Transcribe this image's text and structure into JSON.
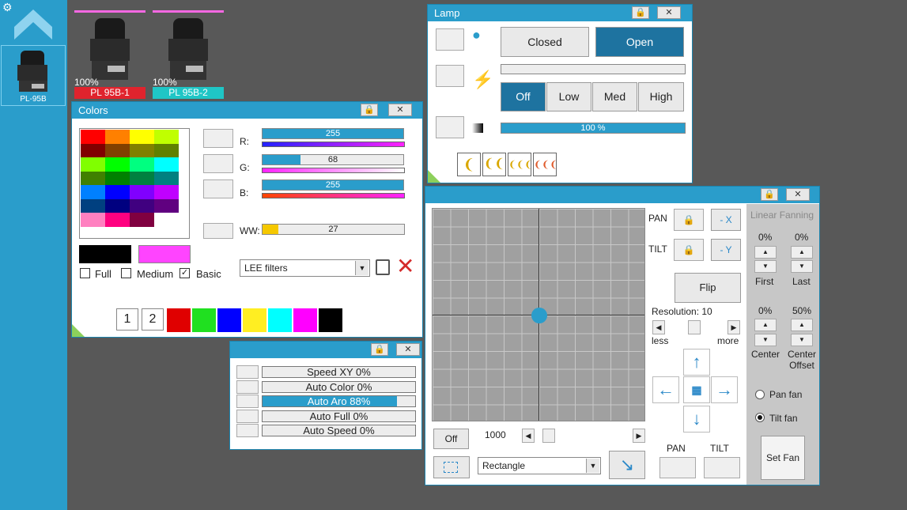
{
  "sidebar": {
    "fixture_label": "PL-95B"
  },
  "fixtures": [
    {
      "percent": "100%",
      "name": "PL 95B-1",
      "color": "#e0232d"
    },
    {
      "percent": "100%",
      "name": "PL 95B-2",
      "color": "#1fc6c6"
    }
  ],
  "lamp": {
    "title": "Lamp",
    "closed_label": "Closed",
    "open_label": "Open",
    "power_levels": [
      "Off",
      "Low",
      "Med",
      "High"
    ],
    "active_power": "Off",
    "dimmer_text": "100 %",
    "dimmer_value": 1.0
  },
  "colors": {
    "title": "Colors",
    "channels": [
      {
        "label": "R:",
        "value": "255",
        "fraction": 1.0
      },
      {
        "label": "G:",
        "value": "68",
        "fraction": 0.27
      },
      {
        "label": "B:",
        "value": "255",
        "fraction": 1.0
      },
      {
        "label": "WW:",
        "value": "27",
        "fraction": 0.11
      }
    ],
    "current_color": "#000000",
    "target_color": "#ff44ff",
    "palette": [
      [
        "#ff0000",
        "#ff8000",
        "#ffff00",
        "#c0ff00"
      ],
      [
        "#800000",
        "#804000",
        "#808000",
        "#608000"
      ],
      [
        "#80ff00",
        "#00ff00",
        "#00ff80",
        "#00ffff"
      ],
      [
        "#408000",
        "#008000",
        "#008040",
        "#008080"
      ],
      [
        "#0080ff",
        "#0000ff",
        "#8000ff",
        "#c000ff"
      ],
      [
        "#004080",
        "#000080",
        "#400080",
        "#600080"
      ],
      [
        "#ff80c0",
        "#ff0080",
        "#800040",
        "#ffffff"
      ]
    ],
    "modes": [
      {
        "label": "Full",
        "checked": false
      },
      {
        "label": "Medium",
        "checked": false
      },
      {
        "label": "Basic",
        "checked": true
      }
    ],
    "filter_select": "LEE filters",
    "pages": [
      "1",
      "2"
    ],
    "quick_colors": [
      "#e00000",
      "#20e020",
      "#0000ff",
      "#ffee22",
      "#00ffff",
      "#ff00ff",
      "#000000"
    ]
  },
  "auto": {
    "rows": [
      {
        "label": "Speed XY",
        "value": "0%",
        "fraction": 0.0
      },
      {
        "label": "Auto Color",
        "value": "0%",
        "fraction": 0.0
      },
      {
        "label": "Auto Aro",
        "value": "88%",
        "fraction": 0.88
      },
      {
        "label": "Auto Full",
        "value": "0%",
        "fraction": 0.0
      },
      {
        "label": "Auto Speed",
        "value": "0%",
        "fraction": 0.0
      }
    ]
  },
  "pantilt": {
    "pan_label": "PAN",
    "tilt_label": "TILT",
    "invert_x": "- X",
    "invert_y": "- Y",
    "flip_label": "Flip",
    "resolution_label": "Resolution: 10",
    "less_label": "less",
    "more_label": "more",
    "off_label": "Off",
    "speed_value": "1000",
    "shape_select": "Rectangle",
    "pan_footer": "PAN",
    "tilt_footer": "TILT",
    "position": {
      "pan": 0.5,
      "tilt": 0.5
    }
  },
  "fanning": {
    "title": "Linear Fanning",
    "first_value": "0%",
    "last_value": "0%",
    "first_label": "First",
    "last_label": "Last",
    "center_value": "0%",
    "offset_value": "50%",
    "center_label": "Center",
    "offset_label": "Center Offset",
    "pan_fan_label": "Pan fan",
    "tilt_fan_label": "Tilt fan",
    "selected": "Tilt fan",
    "set_fan_label": "Set Fan"
  }
}
